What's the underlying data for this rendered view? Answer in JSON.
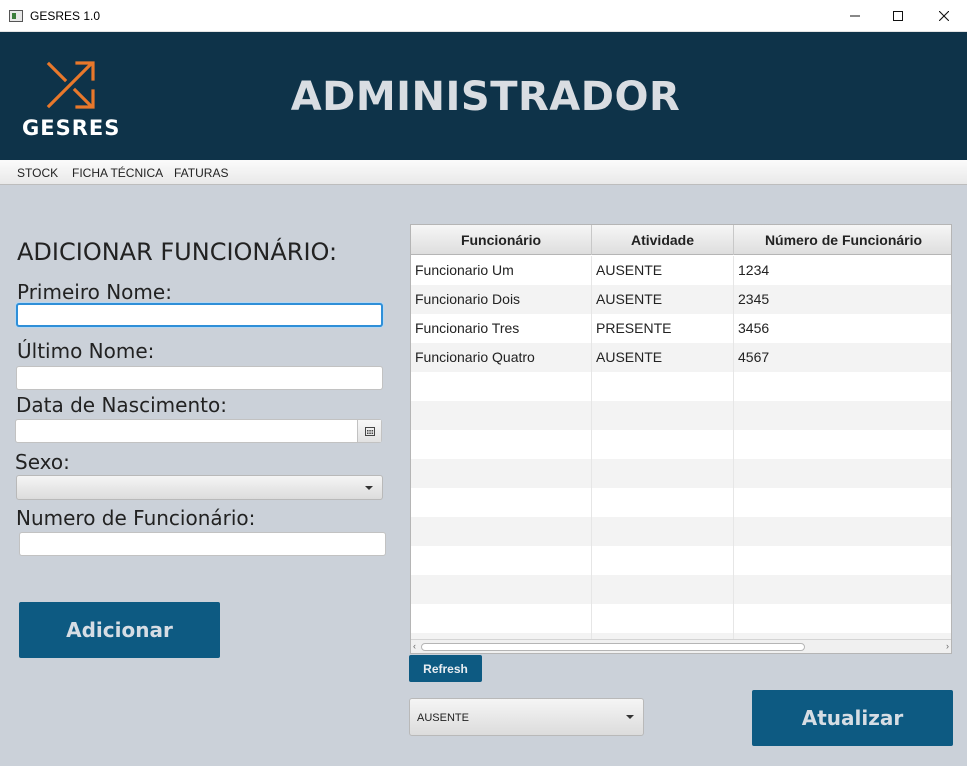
{
  "window": {
    "title": "GESRES 1.0",
    "controls": [
      "minimize-icon",
      "maximize-icon",
      "close-icon"
    ]
  },
  "header": {
    "logo_text": "GESRES",
    "title": "ADMINISTRADOR",
    "colors": {
      "background": "#0e3349",
      "logo_accent": "#e8782b",
      "title": "#d9dde2"
    }
  },
  "menu": {
    "items": [
      "STOCK",
      "FICHA TÉCNICA",
      "FATURAS"
    ]
  },
  "form": {
    "heading": "ADICIONAR FUNCIONÁRIO:",
    "first_name_label": "Primeiro Nome:",
    "first_name_value": "",
    "last_name_label": "Último Nome:",
    "last_name_value": "",
    "birth_date_label": "Data de Nascimento:",
    "birth_date_value": "",
    "sex_label": "Sexo:",
    "sex_value": "",
    "employee_number_label": "Numero de Funcionário:",
    "employee_number_value": "",
    "add_button": "Adicionar"
  },
  "table": {
    "columns": [
      "Funcionário",
      "Atividade",
      "Número de Funcionário"
    ],
    "rows": [
      [
        "Funcionario Um",
        "AUSENTE",
        "1234"
      ],
      [
        "Funcionario Dois",
        "AUSENTE",
        "2345"
      ],
      [
        "Funcionario Tres",
        "PRESENTE",
        "3456"
      ],
      [
        "Funcionario Quatro",
        "AUSENTE",
        "4567"
      ]
    ],
    "refresh_button": "Refresh"
  },
  "status_select": {
    "value": "AUSENTE"
  },
  "update_button": "Atualizar",
  "colors": {
    "button": "#0d5a82",
    "page_background": "#cbd1d9"
  }
}
